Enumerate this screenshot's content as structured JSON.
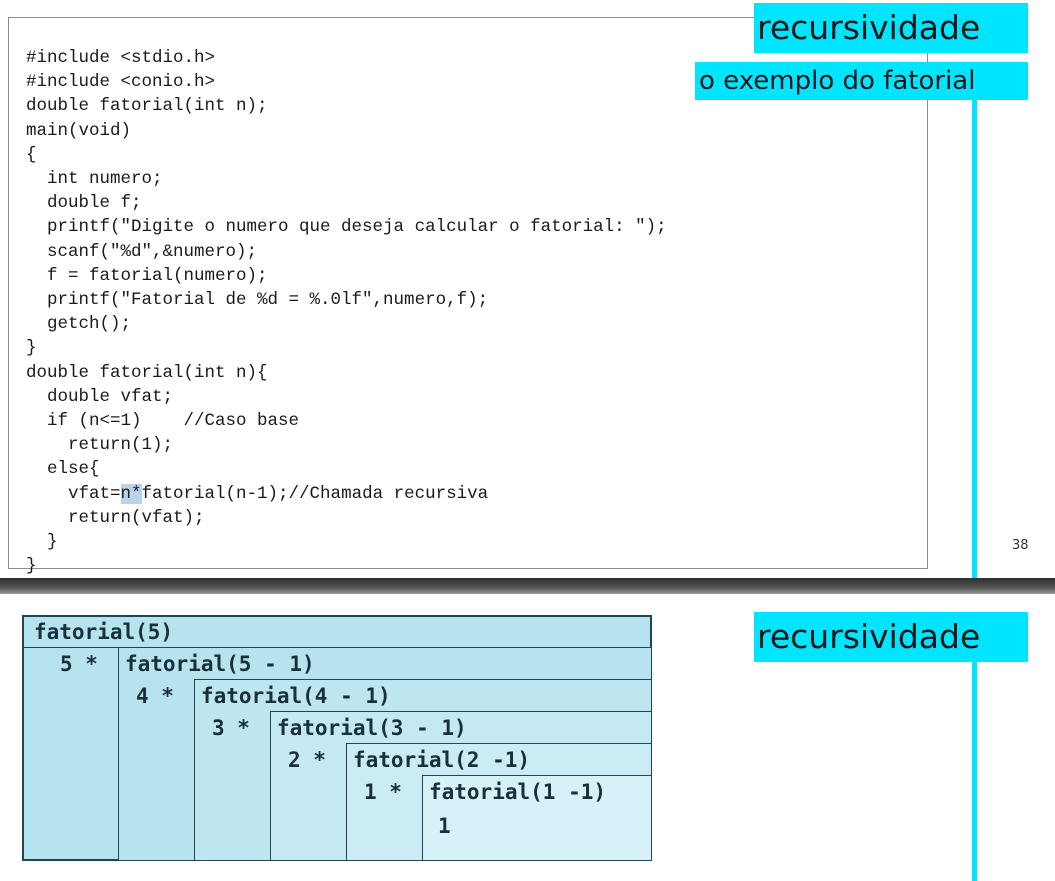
{
  "slide1": {
    "title": "recursividade",
    "subtitle": "o exemplo do fatorial",
    "page_number": "38",
    "code_before_selection": "#include <stdio.h>\n#include <conio.h>\ndouble fatorial(int n);\nmain(void)\n{\n  int numero;\n  double f;\n  printf(\"Digite o numero que deseja calcular o fatorial: \");\n  scanf(\"%d\",&numero);\n  f = fatorial(numero);\n  printf(\"Fatorial de %d = %.0lf\",numero,f);\n  getch();\n}\ndouble fatorial(int n){\n  double vfat;\n  if (n<=1)    //Caso base\n    return(1);\n  else{\n    vfat=",
    "code_selection": "n*",
    "code_after_selection": "fatorial(n-1);//Chamada recursiva\n    return(vfat);\n  }\n}"
  },
  "slide2": {
    "title": "recursividade",
    "calls": [
      {
        "prefix": "",
        "call": "fatorial(5)"
      },
      {
        "prefix": "5 *",
        "call": "fatorial(5 - 1)"
      },
      {
        "prefix": "4 *",
        "call": "fatorial(4 - 1)"
      },
      {
        "prefix": "3 *",
        "call": "fatorial(3 - 1)"
      },
      {
        "prefix": "2 *",
        "call": "fatorial(2 -1)"
      },
      {
        "prefix": "1 *",
        "call": "fatorial(1 -1)"
      }
    ],
    "base_result": "1"
  },
  "colors": {
    "title_highlight": "#00e5ff",
    "diagram_fill": "#b6e3ee",
    "diagram_border": "#1d4756",
    "selection": "#b9d3ea"
  }
}
